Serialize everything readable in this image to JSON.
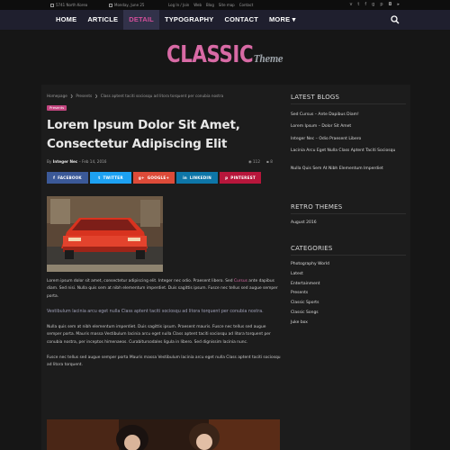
{
  "topbar": {
    "location": "5741 North Korea",
    "date": "Monday, June 25",
    "links": [
      "Log In / Join",
      "Web",
      "Blog",
      "Site map",
      "Contact"
    ],
    "social_icons": [
      "vimeo-icon",
      "twitter-icon",
      "facebook-icon",
      "googleplus-icon",
      "pinterest-icon",
      "instagram-icon",
      "youtube-icon"
    ]
  },
  "nav": {
    "items": [
      {
        "label": "HOME"
      },
      {
        "label": "ARTICLE"
      },
      {
        "label": "DETAIL"
      },
      {
        "label": "TYPOGRAPHY"
      },
      {
        "label": "CONTACT"
      },
      {
        "label": "MORE ▾"
      }
    ],
    "active_index": 2
  },
  "logo": {
    "main": "CLASSIC",
    "sub": "Theme"
  },
  "breadcrumb": {
    "home": "Homepage",
    "sep": "❯",
    "section": "Presents",
    "current": "Class aptent taciti sociosqu ad litora torquent per conubia nostra"
  },
  "post": {
    "category": "Presents",
    "title": "Lorem Ipsum Dolor Sit Amet, Consectetur Adipiscing Elit",
    "by": "By",
    "author": "Integer Nec",
    "date": "– Feb 14, 2016",
    "views": "112",
    "comments": "8",
    "share": [
      {
        "label": "FACEBOOK",
        "icon": "facebook-icon",
        "color": "#3b5998",
        "glyph": "f"
      },
      {
        "label": "TWITTER",
        "icon": "twitter-icon",
        "color": "#1da1f2",
        "glyph": "t"
      },
      {
        "label": "GOOGLE+",
        "icon": "googleplus-icon",
        "color": "#dd4b39",
        "glyph": "g+"
      },
      {
        "label": "LINKEDIN",
        "icon": "linkedin-icon",
        "color": "#0e76a8",
        "glyph": "in"
      },
      {
        "label": "PINTEREST",
        "icon": "pinterest-icon",
        "color": "#b7163b",
        "glyph": "p"
      }
    ],
    "paragraphs": [
      {
        "pre": "Lorem ipsum dolor sit amet, consectetur adipiscing elit. Integer nec odio. Praesent libero. Sed ",
        "link": "Cursus",
        "post": " ante dapibus diam. Sed nisi. Nulla quis sem at nibh elementum imperdiet. Duis sagittis ipsum. Fusce nec tellus sed augue semper porta."
      },
      {
        "quote": "Vestibulum lacinia arcu eget nulla Class aptent taciti sociosqu ad litora torquent per conubia nostra."
      },
      {
        "text": "Nulla quis sem at nibh elementum imperdiet. Duis sagittis ipsum. Praesent mauris. Fusce nec tellus sed augue semper porta. Mauris massa Vestibulum lacinia arcu eget nulla Class aptent taciti sociosqu ad litora torquent per conubia nostra, per inceptos himenaeos. Curabitursodales ligula in libero. Sed dignissim lacinia nunc."
      },
      {
        "text": "Fusce nec tellus sed augue semper porta Mauris massa Vestibulum lacinia arcu eget nulla Class aptent taciti sociosqu ad litora torquent."
      }
    ]
  },
  "sidebar": {
    "latest_title": "LATEST BLOGS",
    "latest": [
      "Sed Cursus – Ante Dapibus Diam!",
      "Lorem Ipsum – Dolor Sit Amet",
      "Integer Nec – Odio Praesent Libero",
      "Lacinia Arcu Eget Nulla Class Aptent Taciti Sociosqu",
      "Nulla Quis Sem At Nibh Elementum Imperdiet"
    ],
    "retro_title": "RETRO THEMES",
    "retro": [
      "August 2016"
    ],
    "categories_title": "CATEGORIES",
    "categories": [
      "Photography World",
      "Latest",
      "Entertainment",
      "Presents",
      "Classic Sports",
      "Classic Songs",
      "Juke box"
    ]
  },
  "colors": {
    "background": "#161616",
    "nav": "#1f1f2e",
    "accent": "#d86aa5"
  }
}
